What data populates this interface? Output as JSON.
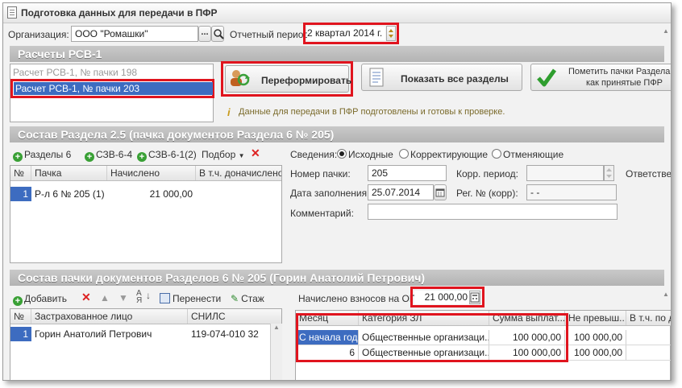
{
  "window": {
    "title": "Подготовка данных для передачи в ПФР"
  },
  "header": {
    "org_label": "Организация:",
    "org_value": "ООО \"Ромашки\"",
    "org_btn": "...",
    "period_label": "Отчетный период:",
    "period_value": "2 квартал 2014 г."
  },
  "rsv": {
    "section_title": "Расчеты РСВ-1",
    "items": [
      "Расчет РСВ-1, № пачки 198",
      "Расчет РСВ-1, № пачки 203"
    ],
    "reform_label": "Переформировать",
    "show_all_label": "Показать все разделы",
    "mark_label_1": "Пометить пачки Раздела",
    "mark_label_2": "как принятые ПФР",
    "info_text": "Данные для передачи в ПФР подготовлены и готовы к проверке."
  },
  "sec25": {
    "section_title": "Состав Раздела 2.5    (пачка документов Раздела 6 № 205)",
    "toolbar": {
      "razdely": "Разделы 6",
      "szv64": "СЗВ-6-4",
      "szv612": "СЗВ-6-1(2)",
      "podbor": "Подбор"
    },
    "columns": [
      "№",
      "Пачка",
      "Начислено",
      "В т.ч. доначислено"
    ],
    "rows": [
      {
        "n": "1",
        "pachka": "Р-л 6 № 205 (1)",
        "nach": "21 000,00",
        "donach": ""
      }
    ],
    "svedeniya_label": "Сведения:",
    "radio": [
      "Исходные",
      "Корректирующие",
      "Отменяющие"
    ],
    "nomer_label": "Номер пачки:",
    "nomer_value": "205",
    "korr_label": "Корр. период:",
    "otv_label": "Ответственн",
    "date_label": "Дата заполнения:",
    "date_value": "25.07.2014",
    "reg_label": "Рег. № (корр):",
    "reg_value": "-  -",
    "comment_label": "Комментарий:"
  },
  "sostav": {
    "section_title": "Состав пачки документов Разделов 6 № 205          (Горин Анатолий Петрович)",
    "toolbar": {
      "add": "Добавить",
      "move": "Перенести",
      "stazh": "Стаж"
    },
    "columns": [
      "№",
      "Застрахованное лицо",
      "СНИЛС"
    ],
    "rows": [
      {
        "n": "1",
        "fio": "Горин Анатолий Петрович",
        "snils": "119-074-010 32"
      }
    ],
    "nachisleno_label": "Начислено взносов на ОПС:",
    "nachisleno_value": "21 000,00",
    "grid2_columns": [
      "Месяц",
      "Категория ЗЛ",
      "Сумма выплат...",
      "Не превыш...",
      "В т.ч. по до"
    ],
    "grid2_rows": [
      {
        "mes": "С начала года",
        "kat": "Общественные организаци...",
        "sum": "100 000,00",
        "ne": "100 000,00"
      },
      {
        "mes": "6",
        "kat": "Общественные организаци...",
        "sum": "100 000,00",
        "ne": "100 000,00"
      }
    ]
  }
}
